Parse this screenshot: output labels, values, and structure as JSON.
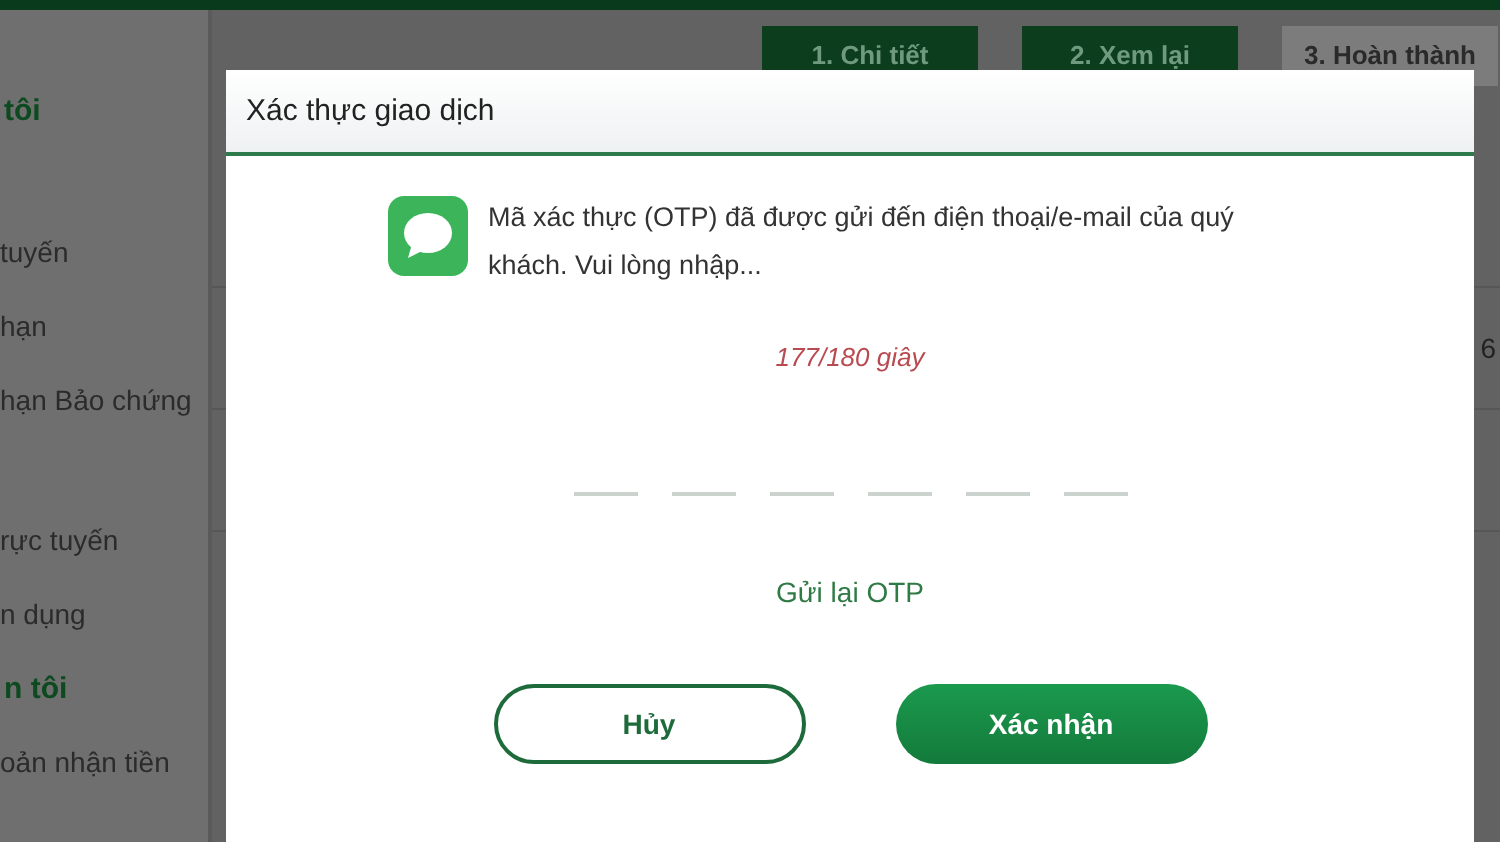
{
  "sidebar": {
    "items": [
      {
        "kind": "heading",
        "text": "tôi"
      },
      {
        "kind": "item",
        "text": "tuyến"
      },
      {
        "kind": "item",
        "text": "hạn"
      },
      {
        "kind": "item",
        "text": "hạn Bảo chứng"
      },
      {
        "kind": "gap"
      },
      {
        "kind": "item",
        "text": "rực tuyến"
      },
      {
        "kind": "item",
        "text": "n dụng"
      },
      {
        "kind": "heading",
        "text": "n tôi"
      },
      {
        "kind": "item",
        "text": "oản nhận tiền"
      }
    ]
  },
  "steps": [
    {
      "label": "1. Chi tiết",
      "active": true
    },
    {
      "label": "2. Xem lại",
      "active": true
    },
    {
      "label": "3. Hoàn thành",
      "active": false
    }
  ],
  "side_fragment": "6",
  "dialog": {
    "title": "Xác thực giao dịch",
    "message": "Mã xác thực (OTP) đã được gửi đến điện thoại/e-mail của quý khách. Vui lòng nhập...",
    "countdown": "177/180 giây",
    "otp_fields": [
      {
        "filled": false
      },
      {
        "filled": false
      },
      {
        "filled": false
      },
      {
        "filled": false
      },
      {
        "filled": false
      },
      {
        "filled": false
      }
    ],
    "resend_link": "Gửi lại OTP",
    "buttons": [
      {
        "kind": "secondary",
        "label": "Hủy"
      },
      {
        "kind": "primary",
        "label": "Xác nhận"
      }
    ]
  }
}
